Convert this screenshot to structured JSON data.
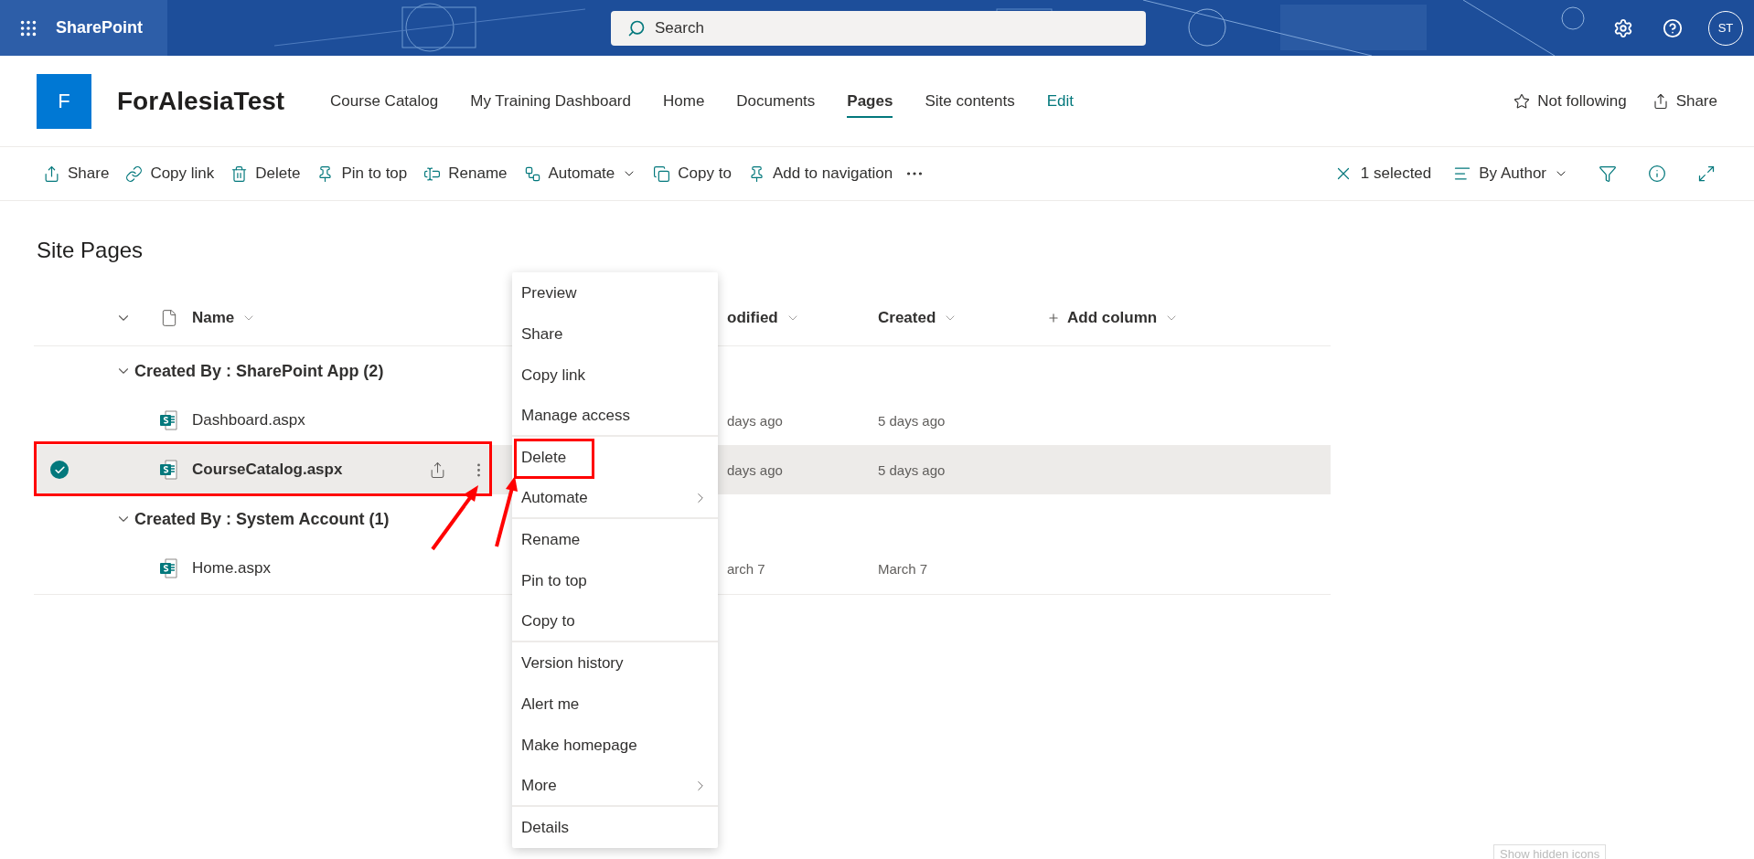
{
  "suite_bar": {
    "app_name": "SharePoint",
    "search_placeholder": "Search",
    "avatar": "ST"
  },
  "site_header": {
    "logo_letter": "F",
    "title": "ForAlesiaTest",
    "nav": [
      {
        "label": "Course Catalog",
        "selected": false,
        "kind": "link"
      },
      {
        "label": "My Training Dashboard",
        "selected": false,
        "kind": "link"
      },
      {
        "label": "Home",
        "selected": false,
        "kind": "link"
      },
      {
        "label": "Documents",
        "selected": false,
        "kind": "link"
      },
      {
        "label": "Pages",
        "selected": true,
        "kind": "link"
      },
      {
        "label": "Site contents",
        "selected": false,
        "kind": "link"
      },
      {
        "label": "Edit",
        "selected": false,
        "kind": "edit"
      }
    ],
    "actions": [
      {
        "label": "Not following",
        "kind": "follow"
      },
      {
        "label": "Share",
        "kind": "share"
      }
    ]
  },
  "command_bar": {
    "commands": [
      {
        "label": "Share",
        "kind": "share"
      },
      {
        "label": "Copy link",
        "kind": "link"
      },
      {
        "label": "Delete",
        "kind": "delete"
      },
      {
        "label": "Pin to top",
        "kind": "pin"
      },
      {
        "label": "Rename",
        "kind": "rename"
      },
      {
        "label": "Automate",
        "kind": "automate"
      },
      {
        "label": "Copy to",
        "kind": "copy"
      },
      {
        "label": "Add to navigation",
        "kind": "navigation"
      },
      {
        "kind": "more"
      }
    ],
    "selection": "1 selected",
    "view": "By Author"
  },
  "library": {
    "title": "Site Pages",
    "columns": [
      {
        "label": "Name",
        "kind": "name"
      },
      {
        "label": "odified",
        "kind": "modified"
      },
      {
        "label": "Created",
        "kind": "created"
      },
      {
        "label": "Add column",
        "kind": "add"
      }
    ],
    "groups": [
      {
        "label": "Created By : SharePoint App (2)",
        "expanded": true,
        "rows": [
          {
            "name": "Dashboard.aspx",
            "modified": "days ago",
            "created": "5 days ago",
            "selected": false,
            "outlined": false
          },
          {
            "name": "CourseCatalog.aspx",
            "modified": "days ago",
            "created": "5 days ago",
            "selected": true,
            "outlined": true
          }
        ]
      },
      {
        "label": "Created By : System Account (1)",
        "expanded": true,
        "rows": [
          {
            "name": "Home.aspx",
            "modified": "arch 7",
            "created": "March 7",
            "selected": false,
            "outlined": false
          }
        ]
      }
    ]
  },
  "context_menu": {
    "items": [
      {
        "label": "Preview",
        "kind": "action",
        "divider_after": false,
        "outlined": false
      },
      {
        "label": "Share",
        "kind": "action",
        "divider_after": false,
        "outlined": false
      },
      {
        "label": "Copy link",
        "kind": "action",
        "divider_after": false,
        "outlined": false
      },
      {
        "label": "Manage access",
        "kind": "action",
        "divider_after": true,
        "outlined": false
      },
      {
        "label": "Delete",
        "kind": "action",
        "divider_after": false,
        "outlined": true
      },
      {
        "label": "Automate",
        "kind": "submenu",
        "divider_after": true,
        "outlined": false
      },
      {
        "label": "Rename",
        "kind": "action",
        "divider_after": false,
        "outlined": false
      },
      {
        "label": "Pin to top",
        "kind": "action",
        "divider_after": false,
        "outlined": false
      },
      {
        "label": "Copy to",
        "kind": "action",
        "divider_after": true,
        "outlined": false
      },
      {
        "label": "Version history",
        "kind": "action",
        "divider_after": false,
        "outlined": false
      },
      {
        "label": "Alert me",
        "kind": "action",
        "divider_after": false,
        "outlined": false
      },
      {
        "label": "Make homepage",
        "kind": "action",
        "divider_after": false,
        "outlined": false
      },
      {
        "label": "More",
        "kind": "submenu",
        "divider_after": true,
        "outlined": false
      },
      {
        "label": "Details",
        "kind": "action",
        "divider_after": false,
        "outlined": false
      }
    ]
  },
  "tooltip": "Show hidden icons"
}
